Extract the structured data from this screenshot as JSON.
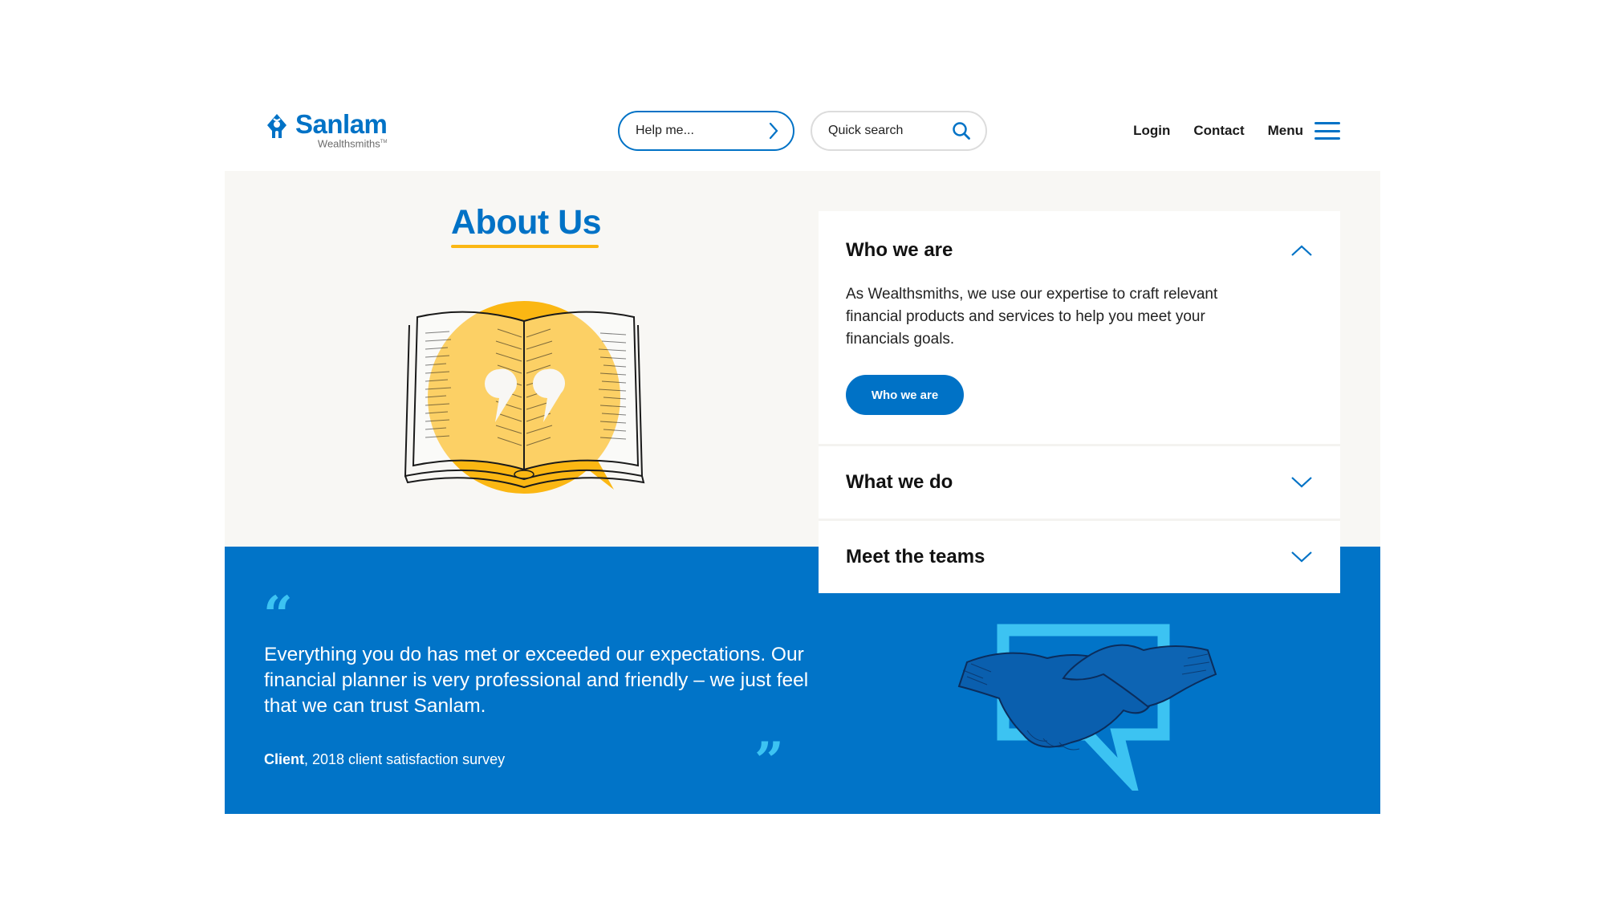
{
  "header": {
    "logo": {
      "brand": "Sanlam",
      "sub": "Wealthsmiths",
      "trademark": "TM",
      "icon": "sanlam-logo-icon"
    },
    "help_pill": {
      "label": "Help me...",
      "icon": "chevron-right-icon"
    },
    "search": {
      "placeholder": "Quick search",
      "value": "",
      "icon": "search-icon"
    },
    "nav": {
      "login": "Login",
      "contact": "Contact",
      "menu": "Menu",
      "menu_icon": "hamburger-icon"
    }
  },
  "hero": {
    "title": "About Us",
    "illustration": "open-book-quote-icon"
  },
  "accordion": {
    "items": [
      {
        "title": "Who we are",
        "expanded": true,
        "body": "As Wealthsmiths, we use our expertise to craft relevant financial products and services to help you meet your financials goals.",
        "button": "Who we are"
      },
      {
        "title": "What we do",
        "expanded": false
      },
      {
        "title": "Meet the teams",
        "expanded": false
      }
    ]
  },
  "testimonial": {
    "open_quote": "“",
    "close_quote": "”",
    "text": "Everything you do has met or exceeded our expectations. Our financial planner is very professional and friendly – we just feel that we can trust Sanlam.",
    "author": "Client",
    "source": ", 2018 client satisfaction survey",
    "illustration": "handshake-icon"
  },
  "colors": {
    "brand_blue": "#0072c6",
    "band_blue": "#0174c8",
    "accent_yellow": "#fbb713",
    "quote_cyan": "#3cc3f2",
    "panel_beige": "#f8f7f4"
  }
}
